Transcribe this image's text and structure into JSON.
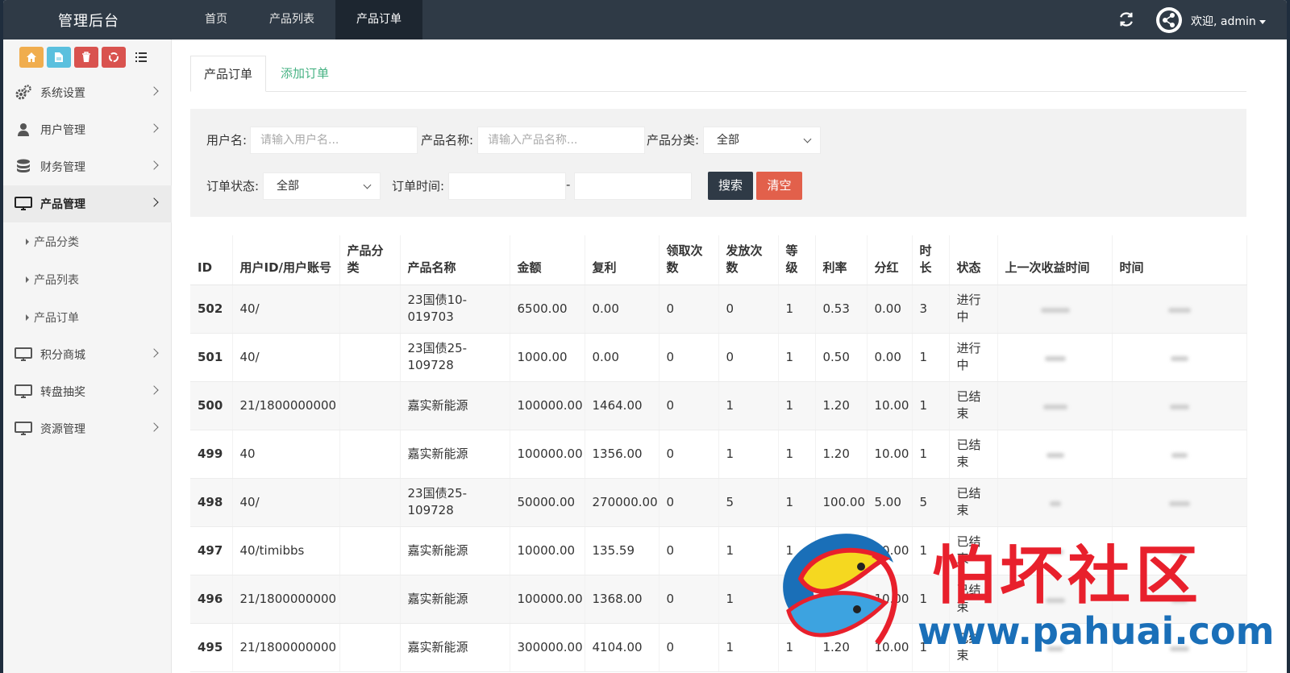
{
  "header": {
    "brand": "管理后台",
    "nav": [
      {
        "label": "首页",
        "active": false
      },
      {
        "label": "产品列表",
        "active": false
      },
      {
        "label": "产品订单",
        "active": true
      }
    ],
    "welcome": "欢迎, admin",
    "refresh_icon": "refresh-icon",
    "avatar_icon": "avatar"
  },
  "sidebar": {
    "quick_buttons": [
      {
        "icon": "home-icon",
        "color": "#f0ad4e"
      },
      {
        "icon": "file-icon",
        "color": "#5bc0de"
      },
      {
        "icon": "trash-icon",
        "color": "#d9534f"
      },
      {
        "icon": "recycle-icon",
        "color": "#d9534f"
      },
      {
        "icon": "list-icon",
        "color": "transparent"
      }
    ],
    "menu": [
      {
        "label": "系统设置",
        "icon": "gears-icon"
      },
      {
        "label": "用户管理",
        "icon": "user-icon"
      },
      {
        "label": "财务管理",
        "icon": "database-icon"
      },
      {
        "label": "产品管理",
        "icon": "monitor-icon",
        "active": true
      }
    ],
    "submenu": [
      "产品分类",
      "产品列表",
      "产品订单"
    ],
    "menu2": [
      {
        "label": "积分商城",
        "icon": "monitor-icon"
      },
      {
        "label": "转盘抽奖",
        "icon": "monitor-icon"
      },
      {
        "label": "资源管理",
        "icon": "monitor-icon"
      }
    ]
  },
  "tabs": {
    "active": "产品订单",
    "link": "添加订单"
  },
  "filter": {
    "username_label": "用户名:",
    "username_placeholder": "请输入用户名...",
    "product_name_label": "产品名称:",
    "product_name_placeholder": "请输入产品名称...",
    "category_label": "产品分类:",
    "category_value": "全部",
    "status_label": "订单状态:",
    "status_value": "全部",
    "time_label": "订单时间:",
    "time_sep": "-",
    "search_btn": "搜索",
    "clear_btn": "清空"
  },
  "table": {
    "headers": [
      "ID",
      "用户ID/用户账号",
      "产品分类",
      "产品名称",
      "金额",
      "复利",
      "领取次数",
      "发放次数",
      "等级",
      "利率",
      "分红",
      "时长",
      "状态",
      "上一次收益时间",
      "时间"
    ],
    "rows": [
      {
        "id": "502",
        "user": "40/",
        "category": "",
        "name": "23国债10-019703",
        "amount": "6500.00",
        "compound": "0.00",
        "claim": "0",
        "issue": "0",
        "level": "1",
        "rate": "0.53",
        "bonus": "0.00",
        "duration": "3",
        "status": "进行中"
      },
      {
        "id": "501",
        "user": "40/",
        "category": "",
        "name": "23国债25-109728",
        "amount": "1000.00",
        "compound": "0.00",
        "claim": "0",
        "issue": "0",
        "level": "1",
        "rate": "0.50",
        "bonus": "0.00",
        "duration": "1",
        "status": "进行中"
      },
      {
        "id": "500",
        "user": "21/1800000000",
        "category": "",
        "name": "嘉实新能源",
        "amount": "100000.00",
        "compound": "1464.00",
        "claim": "0",
        "issue": "1",
        "level": "1",
        "rate": "1.20",
        "bonus": "10.00",
        "duration": "1",
        "status": "已结束"
      },
      {
        "id": "499",
        "user": "40",
        "category": "",
        "name": "嘉实新能源",
        "amount": "100000.00",
        "compound": "1356.00",
        "claim": "0",
        "issue": "1",
        "level": "1",
        "rate": "1.20",
        "bonus": "10.00",
        "duration": "1",
        "status": "已结束"
      },
      {
        "id": "498",
        "user": "40/",
        "category": "",
        "name": "23国债25-109728",
        "amount": "50000.00",
        "compound": "270000.00",
        "claim": "0",
        "issue": "5",
        "level": "1",
        "rate": "100.00",
        "bonus": "5.00",
        "duration": "5",
        "status": "已结束"
      },
      {
        "id": "497",
        "user": "40/timibbs",
        "category": "",
        "name": "嘉实新能源",
        "amount": "10000.00",
        "compound": "135.59",
        "claim": "0",
        "issue": "1",
        "level": "1",
        "rate": "1.20",
        "bonus": "10.00",
        "duration": "1",
        "status": "已结束"
      },
      {
        "id": "496",
        "user": "21/1800000000",
        "category": "",
        "name": "嘉实新能源",
        "amount": "100000.00",
        "compound": "1368.00",
        "claim": "0",
        "issue": "1",
        "level": "1",
        "rate": "1.20",
        "bonus": "10.00",
        "duration": "1",
        "status": "已结束"
      },
      {
        "id": "495",
        "user": "21/1800000000",
        "category": "",
        "name": "嘉实新能源",
        "amount": "300000.00",
        "compound": "4104.00",
        "claim": "0",
        "issue": "1",
        "level": "1",
        "rate": "1.20",
        "bonus": "10.00",
        "duration": "1",
        "status": "已结束"
      }
    ]
  },
  "watermark": {
    "text": "怕坏社区",
    "url": "www.pahuai.com"
  }
}
